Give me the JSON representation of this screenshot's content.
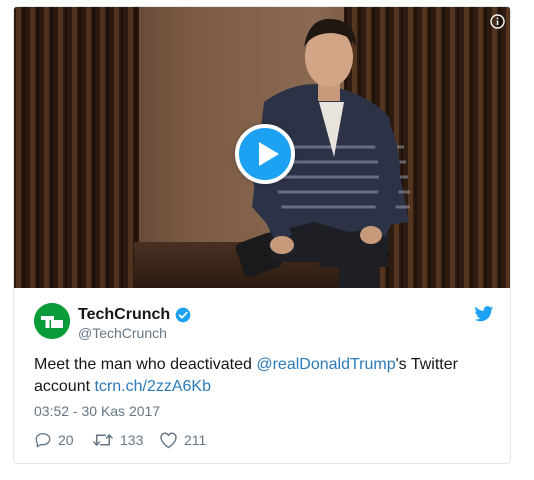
{
  "tweet": {
    "author": {
      "name": "TechCrunch",
      "handle": "@TechCrunch",
      "avatar_icon": "techcrunch-logo",
      "avatar_color": "#0a9b3a",
      "avatar_text": "TC"
    },
    "text_before": "Meet the man who deactivated ",
    "mention": "@realDonaldTrump",
    "text_middle": "'s Twitter account ",
    "link": "tcrn.ch/2zzA6Kb",
    "timestamp": "03:52 - 30 Kas 2017",
    "stats": {
      "replies": "20",
      "retweets": "133",
      "likes": "211"
    }
  },
  "colors": {
    "accent": "#1da1f2",
    "link": "#2b7bb9",
    "muted": "#657786",
    "text": "#14171a",
    "border": "#e1e8ed"
  }
}
